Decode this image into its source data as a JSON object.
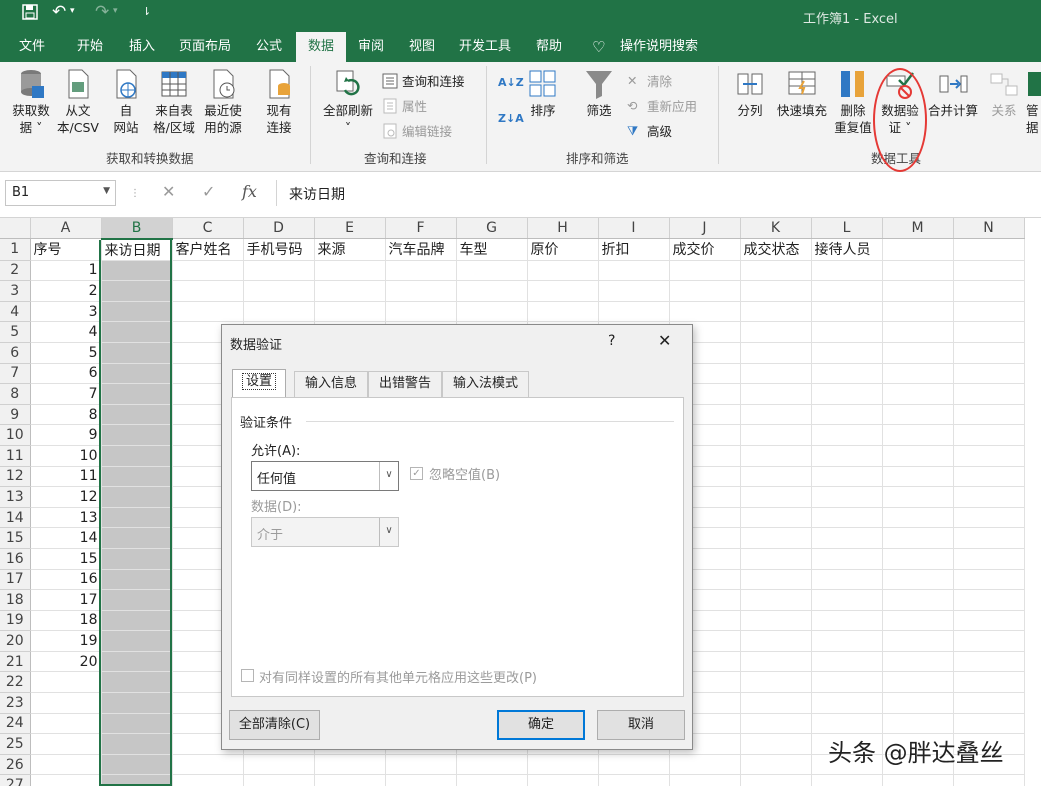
{
  "window": {
    "title": "工作簿1  -  Excel"
  },
  "menu_tabs": [
    "文件",
    "开始",
    "插入",
    "页面布局",
    "公式",
    "数据",
    "审阅",
    "视图",
    "开发工具",
    "帮助",
    "操作说明搜索"
  ],
  "active_tab": "数据",
  "ribbon": {
    "get_data": {
      "get_data": "获取数\n据 ˅",
      "from_csv": "从文\n本/CSV",
      "from_web": "自\n网站",
      "from_table": "来自表\n格/区域",
      "recent": "最近使\n用的源",
      "existing": "现有\n连接",
      "group": "获取和转换数据"
    },
    "queries": {
      "refresh_all": "全部刷新\n˅",
      "queries_conn": "查询和连接",
      "properties": "属性",
      "edit_links": "编辑链接",
      "group": "查询和连接"
    },
    "sort_filter": {
      "sort": "排序",
      "filter": "筛选",
      "clear": "清除",
      "reapply": "重新应用",
      "advanced": "高级",
      "group": "排序和筛选"
    },
    "data_tools": {
      "text_to_cols": "分列",
      "flash_fill": "快速填充",
      "remove_dup": "删除\n重复值",
      "data_validation": "数据验\n证 ˅",
      "consolidate": "合并计算",
      "relations": "关系",
      "manage": "管\n据",
      "group": "数据工具"
    }
  },
  "formula_bar": {
    "name_box": "B1",
    "content": "来访日期"
  },
  "sheet": {
    "columns": [
      "A",
      "B",
      "C",
      "D",
      "E",
      "F",
      "G",
      "H",
      "I",
      "J",
      "K",
      "L",
      "M",
      "N"
    ],
    "headers": [
      "序号",
      "来访日期",
      "客户姓名",
      "手机号码",
      "来源",
      "汽车品牌",
      "车型",
      "原价",
      "折扣",
      "成交价",
      "成交状态",
      "接待人员",
      "",
      ""
    ],
    "row_numbers": [
      "1",
      "2",
      "3",
      "4",
      "5",
      "6",
      "7",
      "8",
      "9",
      "10",
      "11",
      "12",
      "13",
      "14",
      "15",
      "16",
      "17",
      "18",
      "19",
      "20",
      "21",
      "22",
      "23",
      "24",
      "25",
      "26",
      "27"
    ],
    "seq_values": [
      "1",
      "2",
      "3",
      "4",
      "5",
      "6",
      "7",
      "8",
      "9",
      "10",
      "11",
      "12",
      "13",
      "14",
      "15",
      "16",
      "17",
      "18",
      "19",
      "20"
    ]
  },
  "dialog": {
    "title": "数据验证",
    "help": "?",
    "tabs": [
      "设置",
      "输入信息",
      "出错警告",
      "输入法模式"
    ],
    "section": "验证条件",
    "allow_label": "允许(A):",
    "allow_value": "任何值",
    "ignore_blank": "忽略空值(B)",
    "data_label": "数据(D):",
    "data_value": "介于",
    "apply_all": "对有同样设置的所有其他单元格应用这些更改(P)",
    "clear_all": "全部清除(C)",
    "ok": "确定",
    "cancel": "取消"
  },
  "watermark": "头条 @胖达叠丝",
  "colors": {
    "excel_green": "#217346",
    "highlight": "#e53935"
  }
}
